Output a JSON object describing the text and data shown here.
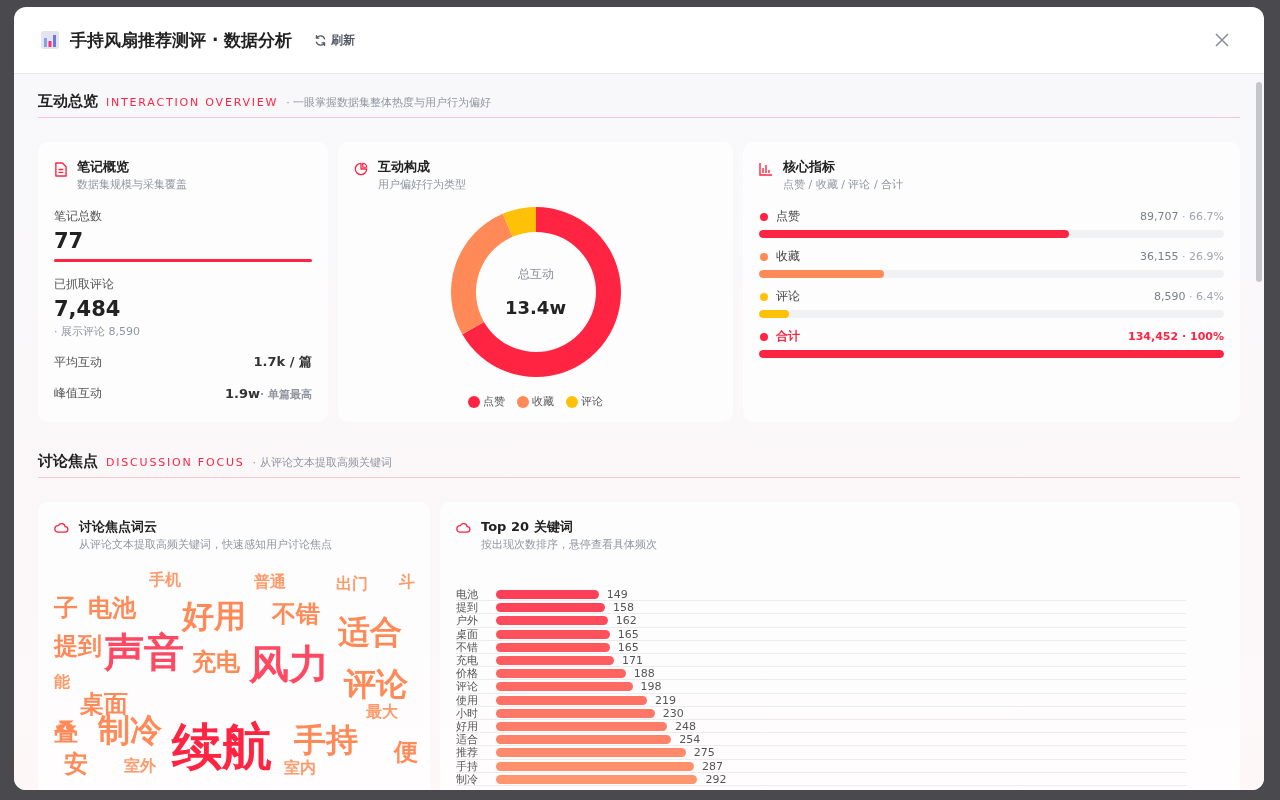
{
  "window": {
    "title": "手持风扇推荐测评 · 数据分析",
    "refresh": "刷新"
  },
  "overview": {
    "title": "互动总览",
    "subtitle_en": "INTERACTION OVERVIEW",
    "description": "· 一眼掌握数据集整体热度与用户行为偏好",
    "notes_card": {
      "title": "笔记概览",
      "subtitle": "数据集规模与采集覆盖",
      "total_label": "笔记总数",
      "total_value": "77",
      "comments_label": "已抓取评论",
      "comments_value": "7,484",
      "comments_note": "· 展示评论 8,590",
      "stats": [
        {
          "label": "平均互动",
          "value": "1.7k / 篇"
        },
        {
          "label": "峰值互动",
          "value": "1.9w",
          "note": "· 单篇最高"
        }
      ]
    },
    "composition_card": {
      "title": "互动构成",
      "subtitle": "用户偏好行为类型",
      "center_label": "总互动",
      "center_value": "13.4w",
      "chart_data": {
        "type": "donut",
        "categories": [
          "点赞",
          "收藏",
          "评论"
        ],
        "values": [
          66.7,
          26.9,
          6.4
        ],
        "colors": [
          "#ff2442",
          "#ff8a57",
          "#ffc107"
        ]
      }
    },
    "metrics_card": {
      "title": "核心指标",
      "subtitle": "点赞 / 收藏 / 评论 / 合计",
      "metrics": [
        {
          "kind": "item",
          "label": "点赞",
          "value": "89,707",
          "share": "· 66.7%",
          "level": 0.667,
          "color": "#ff2442"
        },
        {
          "kind": "item",
          "label": "收藏",
          "value": "36,155",
          "share": "· 26.9%",
          "level": 0.269,
          "color": "#ff8a57"
        },
        {
          "kind": "item",
          "label": "评论",
          "value": "8,590",
          "share": "· 6.4%",
          "level": 0.064,
          "color": "#ffc107"
        },
        {
          "kind": "total",
          "label": "合计",
          "value": "134,452",
          "share": "· 100%",
          "level": 1,
          "color": "#ff2442"
        }
      ]
    }
  },
  "discussion": {
    "title": "讨论焦点",
    "subtitle_en": "DISCUSSION FOCUS",
    "description": "· 从评论文本提取高频关键词",
    "cloud_card": {
      "title": "讨论焦点词云",
      "subtitle": "从评论文本提取高频关键词，快速感知用户讨论焦点",
      "words": [
        {
          "text": "手机",
          "kind": "s"
        },
        {
          "text": "普通",
          "kind": "s"
        },
        {
          "text": "出门",
          "kind": "s"
        },
        {
          "text": "斗",
          "kind": "s"
        },
        {
          "text": "子",
          "kind": "m"
        },
        {
          "text": "电池",
          "kind": "m"
        },
        {
          "text": "好用",
          "kind": "l"
        },
        {
          "text": "不错",
          "kind": "m"
        },
        {
          "text": "提到",
          "kind": "m"
        },
        {
          "text": "声音",
          "kind": "xl"
        },
        {
          "text": "充电",
          "kind": "m"
        },
        {
          "text": "风力",
          "kind": "xl"
        },
        {
          "text": "适合",
          "kind": "l"
        },
        {
          "text": "能",
          "kind": "s"
        },
        {
          "text": "评论",
          "kind": "l"
        },
        {
          "text": "桌面",
          "kind": "m"
        },
        {
          "text": "最大",
          "kind": "s"
        },
        {
          "text": "叠",
          "kind": "m"
        },
        {
          "text": "制冷",
          "kind": "l"
        },
        {
          "text": "续航",
          "kind": "xxl"
        },
        {
          "text": "手持",
          "kind": "l"
        },
        {
          "text": "便",
          "kind": "m"
        },
        {
          "text": "安",
          "kind": "m"
        },
        {
          "text": "室外",
          "kind": "s"
        },
        {
          "text": "室内",
          "kind": "s"
        }
      ]
    },
    "keywords_card": {
      "title": "Top 20 关键词",
      "subtitle": "按出现次数排序，悬停查看具体频次",
      "chart_data": {
        "type": "bar",
        "orientation": "horizontal",
        "categories": [
          "电池",
          "提到",
          "户外",
          "桌面",
          "不错",
          "充电",
          "价格",
          "评论",
          "使用",
          "小时",
          "好用",
          "适合",
          "推荐",
          "手持",
          "制冷"
        ],
        "values": [
          149,
          158,
          162,
          165,
          165,
          171,
          188,
          198,
          219,
          230,
          248,
          254,
          275,
          287,
          292
        ],
        "data_labels": true
      }
    }
  }
}
